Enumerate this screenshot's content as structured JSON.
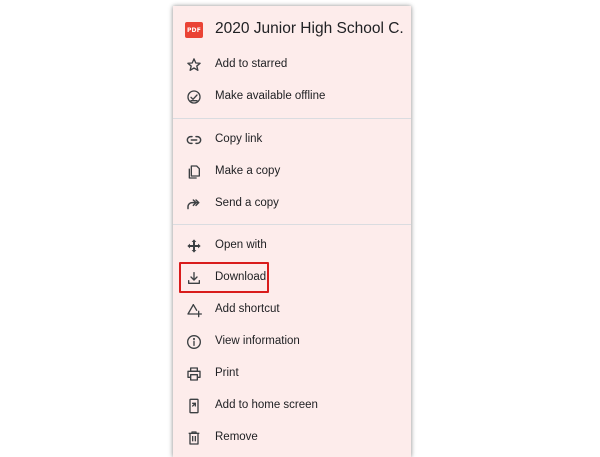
{
  "menu": {
    "file_badge": "PDF",
    "file_title": "2020 Junior High School C...",
    "items": [
      {
        "label": "Add to starred",
        "icon": "star-icon"
      },
      {
        "label": "Make available offline",
        "icon": "offline-check-icon"
      },
      {
        "label": "Copy link",
        "icon": "link-icon"
      },
      {
        "label": "Make a copy",
        "icon": "copy-icon"
      },
      {
        "label": "Send a copy",
        "icon": "send-arrow-icon"
      },
      {
        "label": "Open with",
        "icon": "open-with-icon"
      },
      {
        "label": "Download",
        "icon": "download-icon"
      },
      {
        "label": "Add shortcut",
        "icon": "add-shortcut-icon"
      },
      {
        "label": "View information",
        "icon": "info-icon"
      },
      {
        "label": "Print",
        "icon": "print-icon"
      },
      {
        "label": "Add to home screen",
        "icon": "home-screen-icon"
      },
      {
        "label": "Remove",
        "icon": "trash-icon"
      }
    ]
  },
  "colors": {
    "menu_background": "#fdeceb",
    "pdf_badge": "#ea4335",
    "highlight_border": "#d91c1c",
    "text": "#202124",
    "icon": "#3c4043"
  }
}
